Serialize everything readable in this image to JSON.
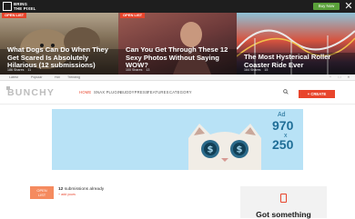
{
  "topbar": {
    "logo_line1": "BRING",
    "logo_line2": "THE PIXEL",
    "button_label": "Buy Now",
    "close_glyph": "✕"
  },
  "heroes": [
    {
      "badge": "OPEN LIST",
      "title": "What Dogs Can Do When They Get Scared Is Absolutely Hilarious (12 submissions)",
      "shares": "186 Shares",
      "comments": "11"
    },
    {
      "badge": "OPEN LIST",
      "title": "Can You Get Through These 12 Sexy Photos Without Saying WOW?",
      "shares": "100 Shares",
      "comments": "13"
    },
    {
      "badge": "",
      "title": "The Most Hysterical Roller Coaster Ride Ever",
      "shares": "164 Shares",
      "comments": "15"
    }
  ],
  "strip": {
    "items": [
      "Latest",
      "Popular",
      "Hot",
      "Trending"
    ],
    "controls": [
      "−",
      "□",
      "✕"
    ]
  },
  "nav": {
    "brand": "BUNCHY",
    "items": [
      "HOME",
      "SNAX PLUGIN",
      "BUDDYPRESS",
      "FEATURES",
      "CATEGORY"
    ],
    "create_label": "+ CREATE"
  },
  "ad": {
    "label": "Ad",
    "size_w": "970",
    "x": "x",
    "size_h": "250"
  },
  "submissions": {
    "badge_line1": "OPEN",
    "badge_line2": "LIST",
    "count": "12",
    "count_rest": "submissions already",
    "add_link": "+ add yours"
  },
  "side": {
    "text": "Got something"
  },
  "colors": {
    "accent": "#e8452c",
    "topbar_bg": "#1e1e1e",
    "buy_green": "#5aa13a",
    "ad_bg": "#b8e2f6"
  }
}
